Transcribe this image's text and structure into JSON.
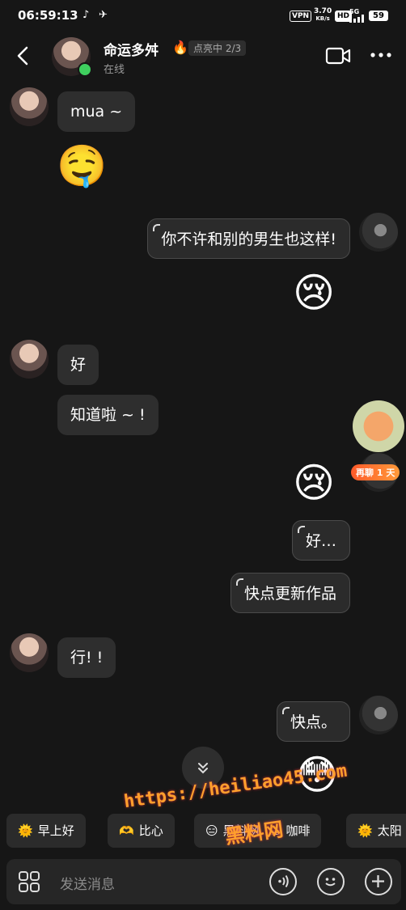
{
  "status_bar": {
    "time": "06:59:13",
    "vpn": "VPN",
    "speed_value": "3.70",
    "speed_unit": "KB/s",
    "hd": "HD",
    "network": "5G",
    "battery": "59"
  },
  "header": {
    "contact_name": "命运多舛",
    "flame_tag": "点亮中 2/3",
    "presence": "在线"
  },
  "messages": [
    {
      "side": "them",
      "text": "mua ~"
    },
    {
      "side": "them",
      "text": "🤤"
    },
    {
      "side": "me",
      "text": "你不许和别的男生也这样!"
    },
    {
      "side": "me",
      "text": "😢"
    },
    {
      "side": "them",
      "text": "好"
    },
    {
      "side": "them",
      "text": "知道啦 ~ !"
    },
    {
      "side": "me",
      "text": "😢"
    },
    {
      "side": "me",
      "text": "好…"
    },
    {
      "side": "me",
      "text": "快点更新作品"
    },
    {
      "side": "them",
      "text": "行! !"
    },
    {
      "side": "me",
      "text": "快点。"
    },
    {
      "side": "me",
      "text": "😳"
    }
  ],
  "streak_badge": "再聊 1 天",
  "quick_replies": [
    {
      "icon": "🌞",
      "label": "早上好"
    },
    {
      "icon": "🫶",
      "label": "比心"
    },
    {
      "icon": "😑",
      "label": "黑料网"
    },
    {
      "icon": "☕",
      "label": "咖啡"
    },
    {
      "icon": "🌞",
      "label": "太阳"
    }
  ],
  "input": {
    "placeholder": "发送消息"
  },
  "watermark": {
    "url": "https://heiliao45.com",
    "site": "黑料网"
  },
  "colors": {
    "background": "#161616",
    "bubble": "#2e2e2e",
    "online": "#3fcf5e",
    "watermark": "#ff9f2d"
  }
}
